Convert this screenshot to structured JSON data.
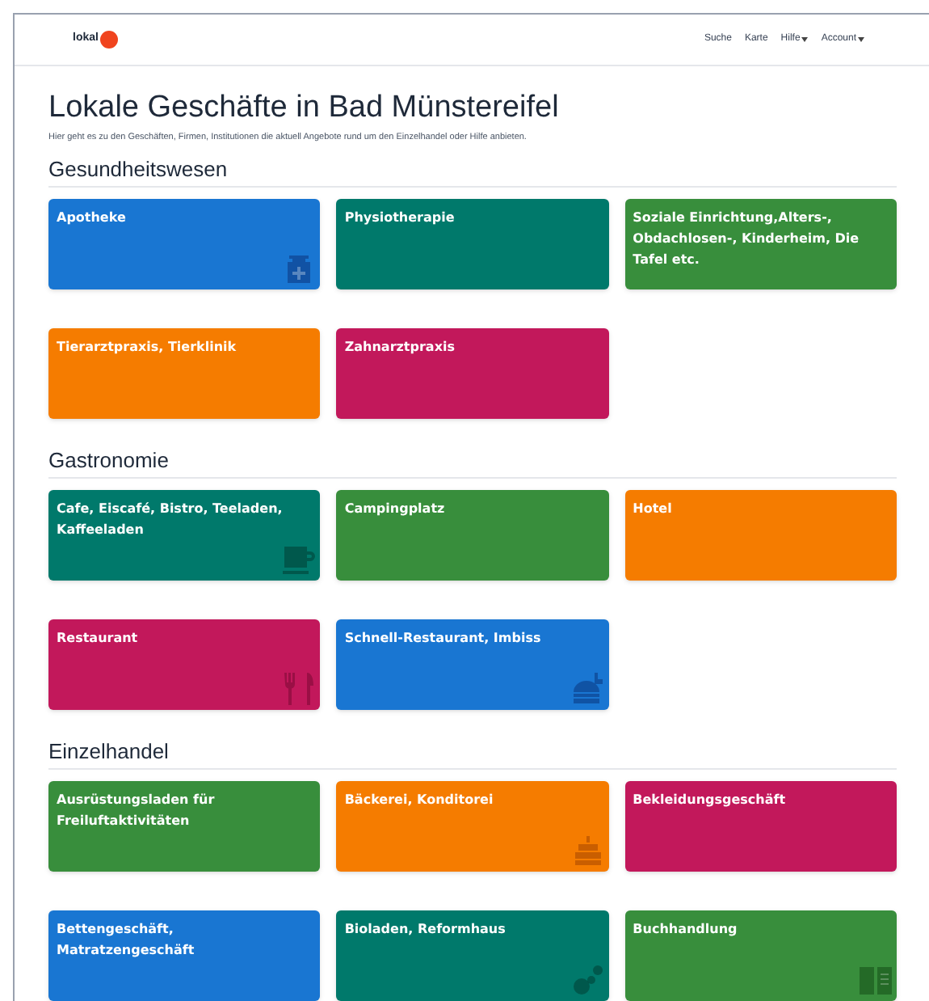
{
  "navbar": {
    "logo": "lokal",
    "links": [
      {
        "label": "Suche",
        "dropdown": false
      },
      {
        "label": "Karte",
        "dropdown": false
      },
      {
        "label": "Hilfe",
        "dropdown": true
      },
      {
        "label": "Account",
        "dropdown": true
      }
    ]
  },
  "title": "Lokale Geschäfte in Bad Münstereifel",
  "subtitle": "Hier geht es zu den Geschäften, Firmen, Institutionen die aktuell Angebote rund um den Einzelhandel oder Hilfe anbieten.",
  "sections": [
    {
      "heading": "Gesundheitswesen",
      "rows": [
        [
          {
            "label": "Apotheke",
            "color": "#1976d2"
          },
          {
            "label": "Physiotherapie",
            "color": "#00796b"
          },
          {
            "label": "Soziale Einrichtung,Alters-, Obdachlosen-, Kinderheim, Die Tafel etc.",
            "color": "#388e3c"
          }
        ],
        [
          {
            "label": "Tierarztpraxis, Tierklinik",
            "color": "#f57c00"
          },
          {
            "label": "Zahnarztpraxis",
            "color": "#c2185b"
          }
        ]
      ]
    },
    {
      "heading": "Gastronomie",
      "rows": [
        [
          {
            "label": "Cafe, Eiscafé, Bistro, Teeladen, Kaffeeladen",
            "color": "#00796b"
          },
          {
            "label": "Campingplatz",
            "color": "#388e3c"
          },
          {
            "label": "Hotel",
            "color": "#f57c00"
          }
        ],
        [
          {
            "label": "Restaurant",
            "color": "#c2185b"
          },
          {
            "label": "Schnell-Restaurant, Imbiss",
            "color": "#1976d2"
          }
        ]
      ]
    },
    {
      "heading": "Einzelhandel",
      "rows": [
        [
          {
            "label": "Ausrüstungsladen für Freiluftaktivitäten",
            "color": "#388e3c"
          },
          {
            "label": "Bäckerei, Konditorei",
            "color": "#f57c00"
          },
          {
            "label": "Bekleidungsgeschäft",
            "color": "#c2185b"
          }
        ],
        [
          {
            "label": "Bettengeschäft, Matratzengeschäft",
            "color": "#1976d2"
          },
          {
            "label": "Bioladen, Reformhaus",
            "color": "#00796b"
          },
          {
            "label": "Buchhandlung",
            "color": "#388e3c"
          }
        ]
      ]
    }
  ]
}
